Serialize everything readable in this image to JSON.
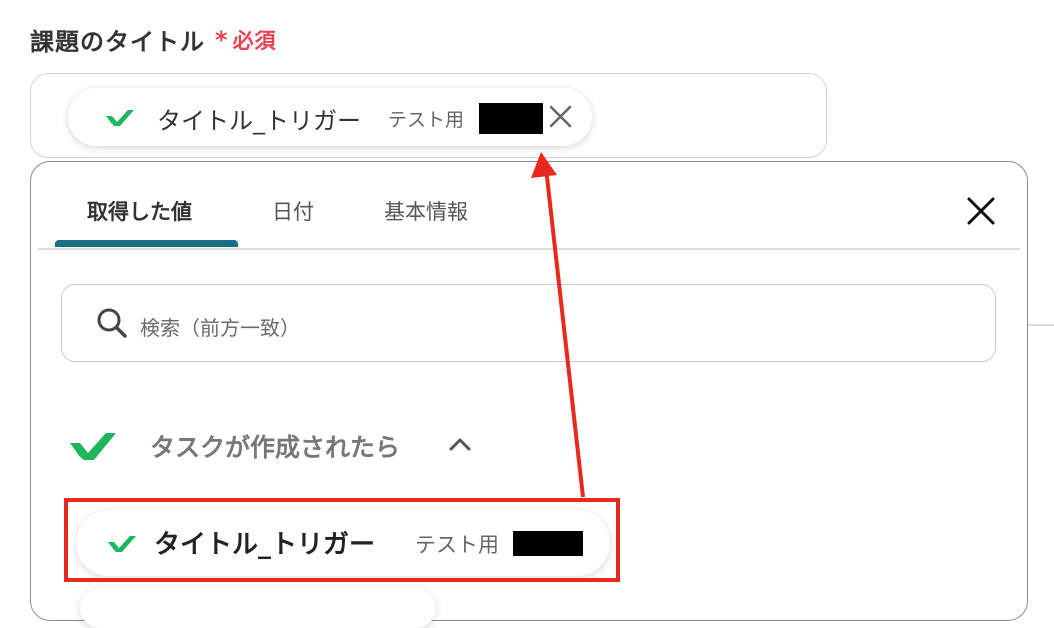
{
  "field": {
    "label": "課題のタイトル",
    "required_mark": "*",
    "required_text": "必須"
  },
  "token": {
    "icon": "wrike-check-icon",
    "name": "タイトル_トリガー",
    "sub": "テスト用"
  },
  "tabs": [
    {
      "label": "取得した値",
      "active": true
    },
    {
      "label": "日付",
      "active": false
    },
    {
      "label": "基本情報",
      "active": false
    }
  ],
  "search": {
    "placeholder": "検索（前方一致）"
  },
  "group": {
    "icon": "wrike-check-icon",
    "title": "タスクが作成されたら",
    "expanded": true
  },
  "items": [
    {
      "name": "タイトル_トリガー",
      "sub": "テスト用"
    }
  ],
  "colors": {
    "required": "#e9434f",
    "tab_indicator": "#1a6e86",
    "brand_green": "#1fb55a",
    "annotation_red": "#e8291d"
  }
}
